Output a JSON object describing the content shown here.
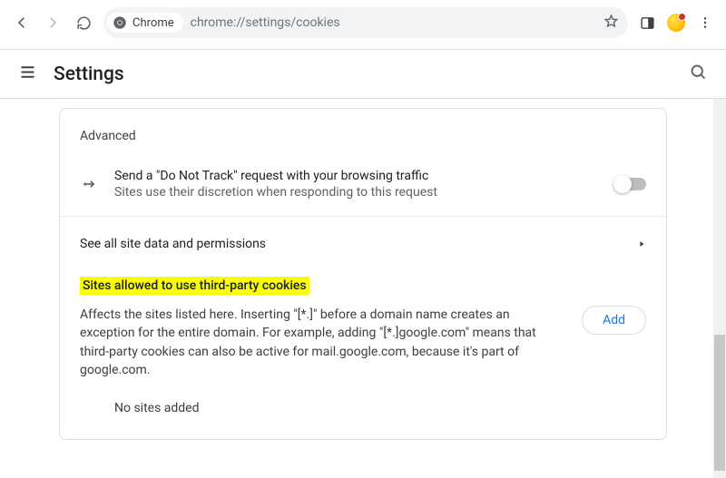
{
  "browser": {
    "chip_label": "Chrome",
    "url": "chrome://settings/cookies"
  },
  "header": {
    "title": "Settings"
  },
  "card": {
    "advanced_heading": "Advanced",
    "dnt": {
      "title": "Send a \"Do Not Track\" request with your browsing traffic",
      "subtitle": "Sites use their discretion when responding to this request"
    },
    "site_data_link": "See all site data and permissions",
    "allowed_section_title": "Sites allowed to use third-party cookies",
    "allowed_description": "Affects the sites listed here. Inserting \"[*.]\" before a domain name creates an exception for the entire domain. For example, adding \"[*.]google.com\" means that third-party cookies can also be active for mail.google.com, because it's part of google.com.",
    "add_button": "Add",
    "empty_text": "No sites added"
  }
}
